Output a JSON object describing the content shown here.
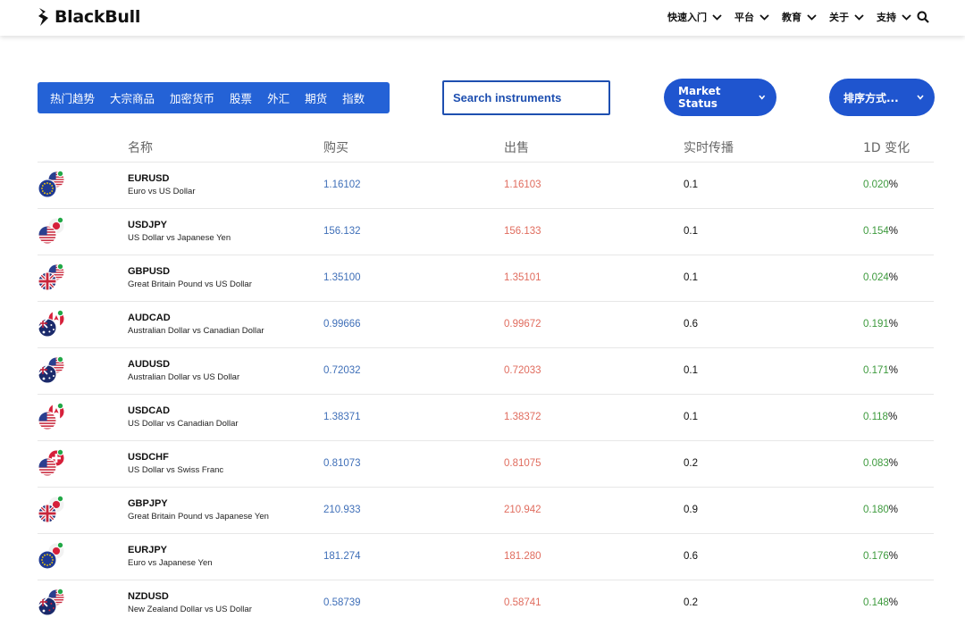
{
  "header": {
    "logo_text": "BlackBull",
    "nav": [
      "快速入门",
      "平台",
      "教育",
      "关于",
      "支持"
    ]
  },
  "filters": {
    "categories": [
      "热门趋势",
      "大宗商品",
      "加密货币",
      "股票",
      "外汇",
      "期货",
      "指数"
    ],
    "search_placeholder": "Search instruments",
    "market_status_label": "Market Status",
    "sort_label": "排序方式..."
  },
  "table": {
    "headers": {
      "name": "名称",
      "buy": "购买",
      "sell": "出售",
      "spread": "实时传播",
      "change": "1D 变化"
    },
    "pct_suffix": "%",
    "rows": [
      {
        "symbol": "EURUSD",
        "desc": "Euro vs US Dollar",
        "buy": "1.16102",
        "sell": "1.16103",
        "spread": "0.1",
        "change": "0.020",
        "flags": [
          "eu",
          "us"
        ]
      },
      {
        "symbol": "USDJPY",
        "desc": "US Dollar vs Japanese Yen",
        "buy": "156.132",
        "sell": "156.133",
        "spread": "0.1",
        "change": "0.154",
        "flags": [
          "us",
          "jp"
        ]
      },
      {
        "symbol": "GBPUSD",
        "desc": "Great Britain Pound vs US Dollar",
        "buy": "1.35100",
        "sell": "1.35101",
        "spread": "0.1",
        "change": "0.024",
        "flags": [
          "gb",
          "us"
        ]
      },
      {
        "symbol": "AUDCAD",
        "desc": "Australian Dollar vs Canadian Dollar",
        "buy": "0.99666",
        "sell": "0.99672",
        "spread": "0.6",
        "change": "0.191",
        "flags": [
          "au",
          "ca"
        ]
      },
      {
        "symbol": "AUDUSD",
        "desc": "Australian Dollar vs US Dollar",
        "buy": "0.72032",
        "sell": "0.72033",
        "spread": "0.1",
        "change": "0.171",
        "flags": [
          "au",
          "us"
        ]
      },
      {
        "symbol": "USDCAD",
        "desc": "US Dollar vs Canadian Dollar",
        "buy": "1.38371",
        "sell": "1.38372",
        "spread": "0.1",
        "change": "0.118",
        "flags": [
          "us",
          "ca"
        ]
      },
      {
        "symbol": "USDCHF",
        "desc": "US Dollar vs Swiss Franc",
        "buy": "0.81073",
        "sell": "0.81075",
        "spread": "0.2",
        "change": "0.083",
        "flags": [
          "us",
          "ch"
        ]
      },
      {
        "symbol": "GBPJPY",
        "desc": "Great Britain Pound vs Japanese Yen",
        "buy": "210.933",
        "sell": "210.942",
        "spread": "0.9",
        "change": "0.180",
        "flags": [
          "gb",
          "jp"
        ]
      },
      {
        "symbol": "EURJPY",
        "desc": "Euro vs Japanese Yen",
        "buy": "181.274",
        "sell": "181.280",
        "spread": "0.6",
        "change": "0.176",
        "flags": [
          "eu",
          "jp"
        ]
      },
      {
        "symbol": "NZDUSD",
        "desc": "New Zealand Dollar vs US Dollar",
        "buy": "0.58739",
        "sell": "0.58741",
        "spread": "0.2",
        "change": "0.148",
        "flags": [
          "nz",
          "us"
        ]
      }
    ]
  },
  "colors": {
    "brand_blue": "#2462d6",
    "buy": "#3f6fb8",
    "sell": "#e06c5e",
    "positive_change": "#3d9a3d",
    "status_dot": "#22a847"
  }
}
